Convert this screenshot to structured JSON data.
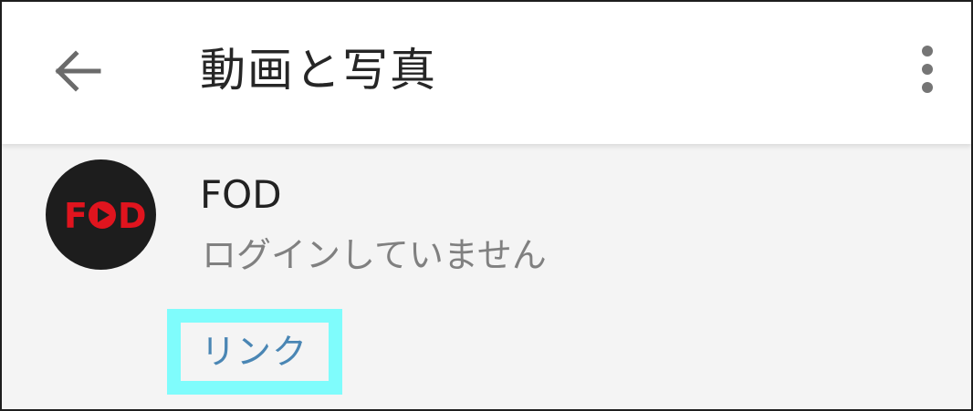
{
  "header": {
    "title": "動画と写真",
    "back_icon": "arrow-left-icon",
    "more_icon": "more-vertical-icon"
  },
  "account": {
    "logo_icon": "fod-logo",
    "logo_text": "FOD",
    "name": "FOD",
    "status": "ログインしていません",
    "link_label": "リンク"
  },
  "colors": {
    "link": "#4a86b4",
    "highlight": "#7ffcfc",
    "logo_red": "#e0141e",
    "logo_bg": "#1d1d1d"
  }
}
